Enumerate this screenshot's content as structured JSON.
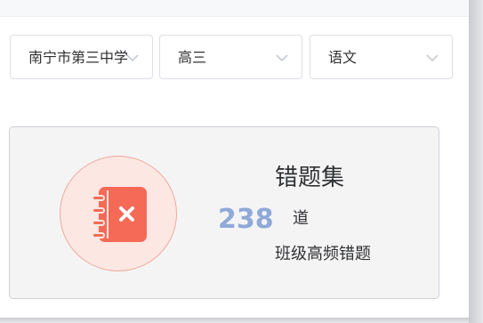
{
  "filters": {
    "school": {
      "value": "南宁市第三中学",
      "icon": "chevron-down-icon"
    },
    "grade": {
      "value": "高三",
      "icon": "chevron-down-icon"
    },
    "subject": {
      "value": "语文",
      "icon": "chevron-down-icon"
    }
  },
  "card": {
    "icon": "wrong-question-book-icon",
    "title": "错题集",
    "count": "238",
    "unit": "道",
    "subtitle": "班级高频错题"
  },
  "colors": {
    "accent_count": "#8fa9d8",
    "icon_red": "#f46a57",
    "icon_circle_bg": "#fce7e3",
    "card_bg": "#f4f4f5"
  }
}
